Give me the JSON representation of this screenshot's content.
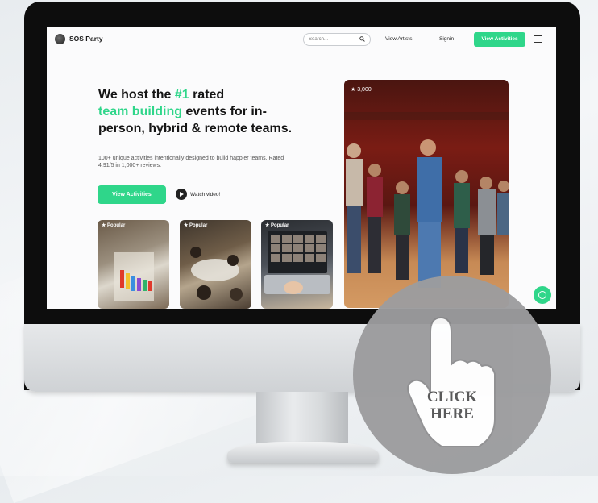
{
  "nav": {
    "brand": "SOS Party",
    "search_placeholder": "Search...",
    "link_artists": "View Artists",
    "link_signin": "Signin",
    "cta": "View Activities"
  },
  "hero": {
    "line1_a": "We host the ",
    "line1_b": "#1",
    "line1_c": " rated",
    "line2_a": "team building",
    "line2_b": " events for in-",
    "line3": "person, hybrid & remote teams.",
    "sub": "100+ unique activities intentionally designed to build happier teams. Rated 4.91/5 in 1,000+ reviews.",
    "cta": "View Activities",
    "watch": "Watch video!"
  },
  "cards": [
    {
      "badge": "★ Popular"
    },
    {
      "badge": "★ Popular"
    },
    {
      "badge": "★ Popular"
    }
  ],
  "photo": {
    "rating": "★ 3,000"
  },
  "overlay": {
    "line1": "CLICK",
    "line2": "HERE"
  },
  "colors": {
    "accent": "#2fd68a"
  }
}
